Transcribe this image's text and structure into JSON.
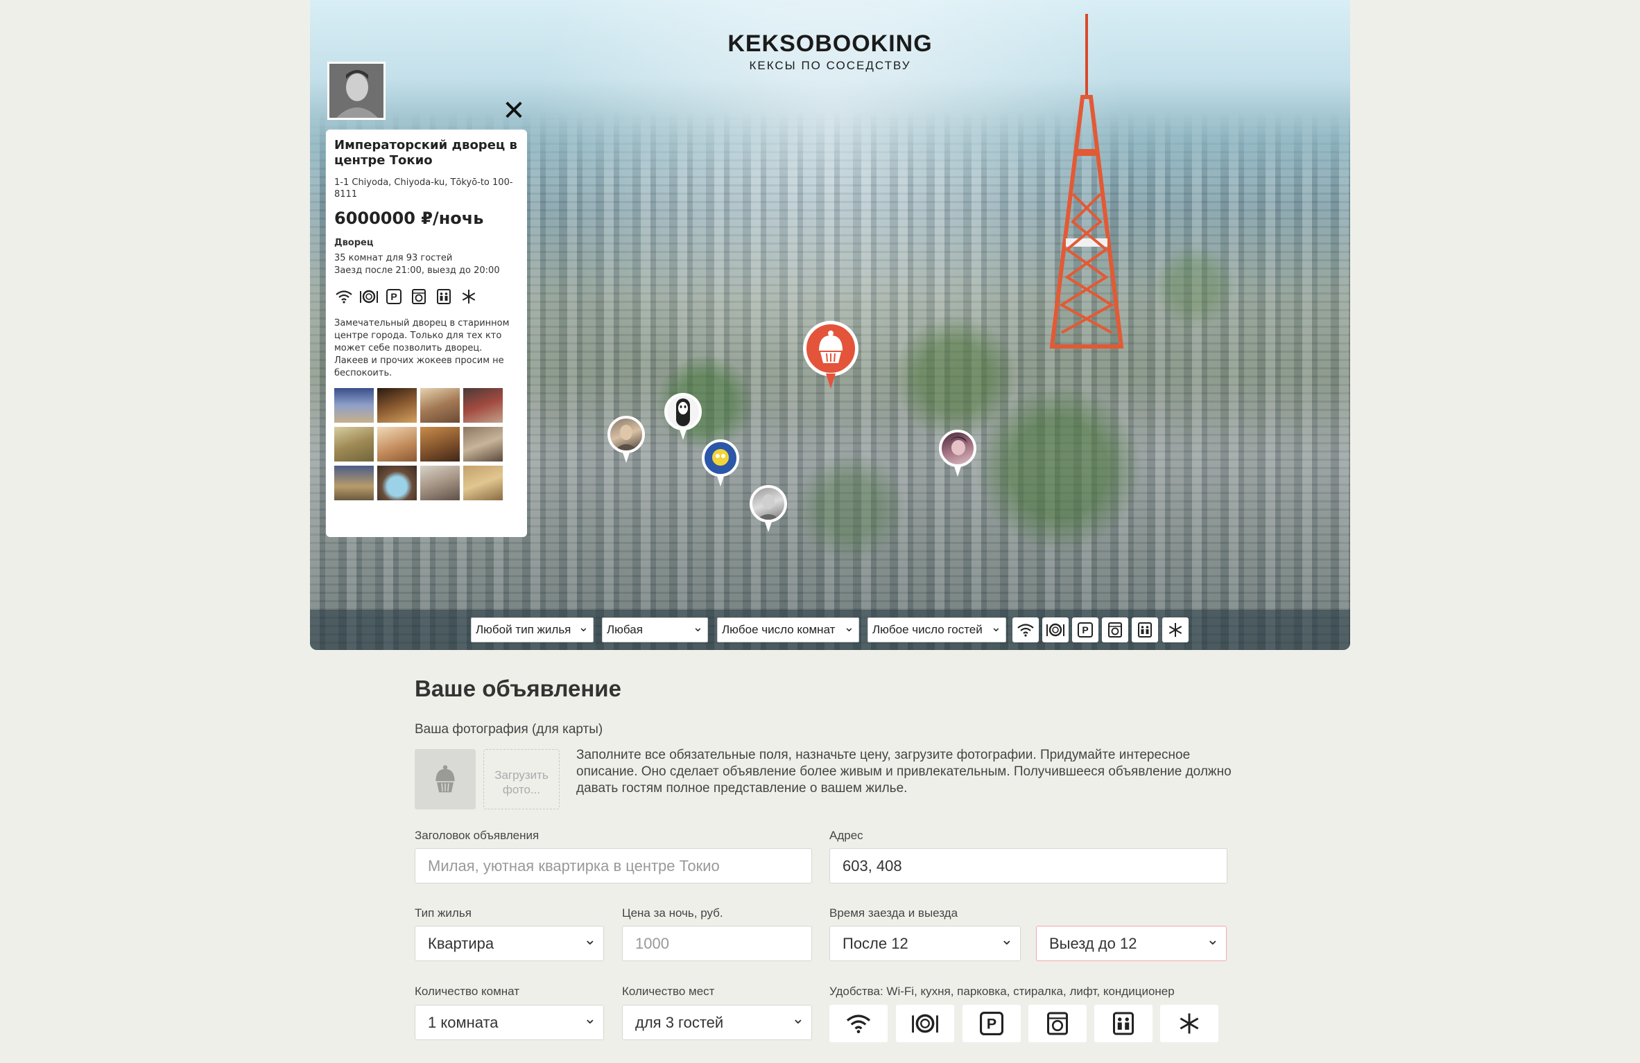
{
  "header": {
    "logo": "KEKSOBOOKING",
    "tagline": "КЕКСЫ ПО СОСЕДСТВУ"
  },
  "popup": {
    "title": "Императорский дворец в центре Токио",
    "address": "1-1 Chiyoda, Chiyoda-ku, Tōkyō-to 100-8111",
    "price": "6000000 ₽/ночь",
    "type": "Дворец",
    "capacity": "35 комнат для 93 гостей",
    "time": "Заезд после 21:00, выезд до 20:00",
    "description": "Замечательный дворец в старинном центре города. Только для тех кто может себе позволить дворец. Лакеев и прочих жокеев просим не беспокоить.",
    "features": [
      "wifi-icon",
      "dishwasher-icon",
      "parking-icon",
      "washer-icon",
      "elevator-icon",
      "conditioner-icon"
    ],
    "close_symbol": "✕"
  },
  "filters": {
    "housing_type": "Любой тип жилья",
    "price": "Любая",
    "rooms": "Любое число комнат",
    "guests": "Любое число гостей"
  },
  "form": {
    "title": "Ваше объявление",
    "avatar_label": "Ваша фотография (для карты)",
    "upload_text": "Загрузить фото...",
    "hint": "Заполните все обязательные поля, назначьте цену, загрузите фотографии. Придумайте интересное описание. Оно сделает объявление более живым и привлекательным. Получившееся объявление должно давать гостям полное представление о вашем жилье.",
    "title_label": "Заголовок объявления",
    "title_placeholder": "Милая, уютная квартирка в центре Токио",
    "address_label": "Адрес",
    "address_value": "603, 408",
    "type_label": "Тип жилья",
    "type_value": "Квартира",
    "price_label": "Цена за ночь, руб.",
    "price_placeholder": "1000",
    "time_label": "Время заезда и выезда",
    "timein_value": "После 12",
    "timeout_value": "Выезд до 12",
    "rooms_label": "Количество комнат",
    "rooms_value": "1 комната",
    "capacity_label": "Количество мест",
    "capacity_value": "для 3 гостей",
    "features_label": "Удобства: Wi-Fi, кухня, парковка, стиралка, лифт, кондиционер"
  },
  "colors": {
    "accent": "#e3543a",
    "background": "#efefea"
  }
}
